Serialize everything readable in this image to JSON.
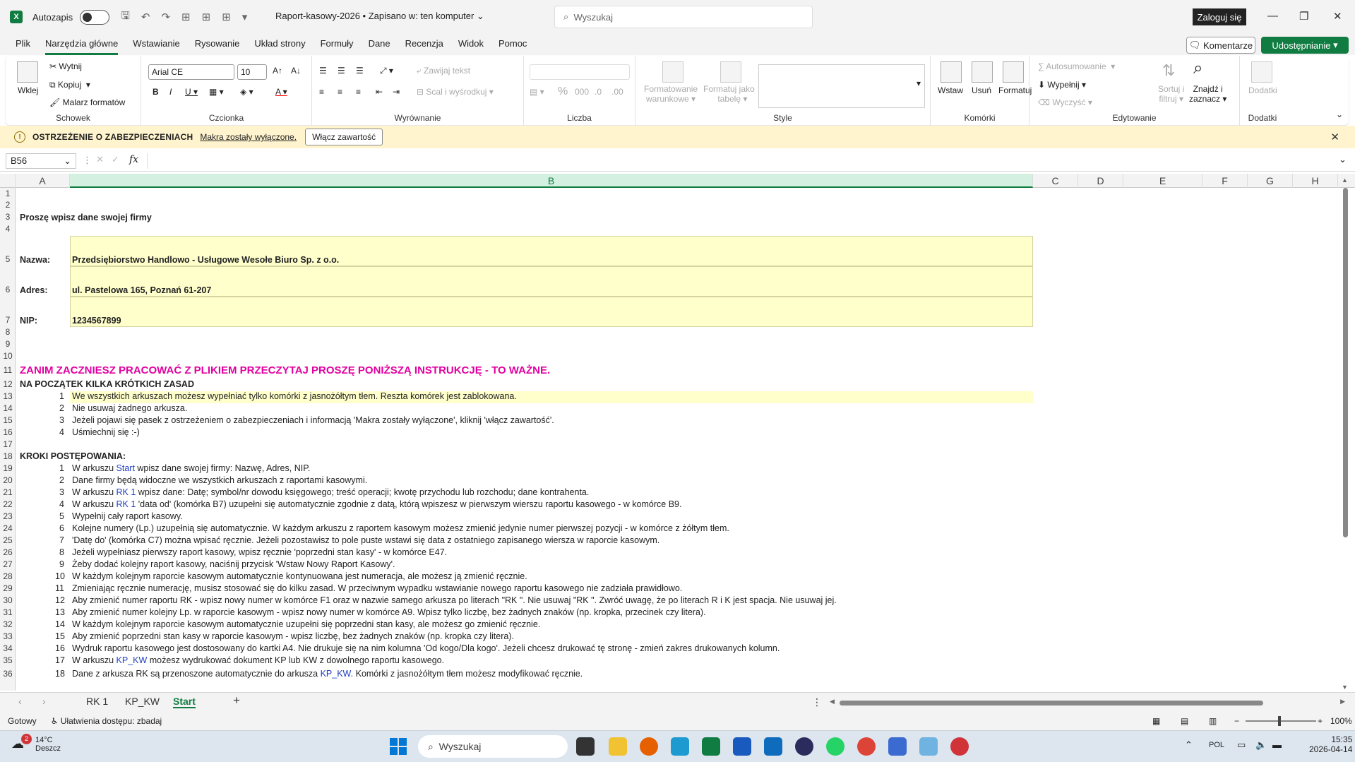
{
  "titlebar": {
    "app_icon": "excel-icon",
    "autosave_label": "Autozapis",
    "document_title": "Raport-kasowy-2026 • Zapisano w: ten komputer",
    "search_placeholder": "Wyszukaj",
    "signin_label": "Zaloguj się"
  },
  "menu": {
    "items": [
      "Plik",
      "Narzędzia główne",
      "Wstawianie",
      "Rysowanie",
      "Układ strony",
      "Formuły",
      "Dane",
      "Recenzja",
      "Widok",
      "Pomoc"
    ],
    "active": "Narzędzia główne",
    "comments_label": "Komentarze",
    "share_label": "Udostępnianie"
  },
  "ribbon": {
    "clipboard": {
      "paste": "Wklej",
      "cut": "Wytnij",
      "copy": "Kopiuj",
      "format_painter": "Malarz formatów",
      "group": "Schowek"
    },
    "font": {
      "family": "Arial CE",
      "size": "10",
      "group": "Czcionka"
    },
    "alignment": {
      "wrap": "Zawijaj tekst",
      "merge": "Scal i wyśrodkuj",
      "group": "Wyrównanie"
    },
    "number": {
      "group": "Liczba"
    },
    "styles": {
      "conditional_l1": "Formatowanie",
      "conditional_l2": "warunkowe",
      "table_l1": "Formatuj jako",
      "table_l2": "tabelę",
      "group": "Style"
    },
    "cells": {
      "insert": "Wstaw",
      "delete": "Usuń",
      "format": "Formatuj",
      "group": "Komórki"
    },
    "editing": {
      "autosum": "Autosumowanie",
      "fill": "Wypełnij",
      "clear": "Wyczyść",
      "sort_l1": "Sortuj i",
      "sort_l2": "filtruj",
      "find_l1": "Znajdź i",
      "find_l2": "zaznacz",
      "group": "Edytowanie"
    },
    "addins": {
      "label": "Dodatki",
      "group": "Dodatki"
    }
  },
  "security_bar": {
    "title": "OSTRZEŻENIE O ZABEZPIECZENIACH",
    "message": "Makra zostały wyłączone.",
    "button": "Włącz zawartość"
  },
  "formula_bar": {
    "name_box": "B56",
    "fx": "fx",
    "formula": ""
  },
  "columns": [
    "A",
    "B",
    "C",
    "D",
    "E",
    "F",
    "G",
    "H"
  ],
  "rows": [
    "1",
    "2",
    "3",
    "4",
    "5",
    "6",
    "7",
    "8",
    "9",
    "10",
    "11",
    "12",
    "13",
    "14",
    "15",
    "16",
    "17",
    "18",
    "19",
    "20",
    "21",
    "22",
    "23",
    "24",
    "25",
    "26",
    "27",
    "28",
    "29",
    "30",
    "31",
    "32",
    "33",
    "34",
    "35",
    "36"
  ],
  "sheet": {
    "r3": "Proszę wpisz dane swojej firmy",
    "r5_label": "Nazwa:",
    "r5_value": "Przedsiębiorstwo Handlowo - Usługowe Wesołe Biuro Sp. z o.o.",
    "r6_label": "Adres:",
    "r6_value": "ul. Pastelowa 165, Poznań 61-207",
    "r7_label": "NIP:",
    "r7_value": "1234567899",
    "r11": "ZANIM ZACZNIESZ PRACOWAĆ Z PLIKIEM PRZECZYTAJ PROSZĘ PONIŻSZĄ INSTRUKCJĘ - TO WAŻNE.",
    "r12": "NA POCZĄTEK KILKA KRÓTKICH ZASAD",
    "rules": [
      {
        "n": "1",
        "t": "We wszystkich arkuszach możesz wypełniać tylko komórki z jasnożółtym tłem. Reszta komórek jest zablokowana."
      },
      {
        "n": "2",
        "t": "Nie usuwaj żadnego arkusza."
      },
      {
        "n": "3",
        "t": "Jeżeli pojawi się pasek z ostrzeżeniem o zabezpieczeniach i informacją 'Makra zostały wyłączone', kliknij 'włącz zawartość'."
      },
      {
        "n": "4",
        "t": "Uśmiechnij się :-)"
      }
    ],
    "r18": "KROKI POSTĘPOWANIA:",
    "steps": [
      {
        "n": "1",
        "pre": "W arkuszu ",
        "link": "Start",
        "post": " wpisz dane swojej firmy: Nazwę, Adres, NIP."
      },
      {
        "n": "2",
        "pre": "Dane firmy będą widoczne we wszystkich arkuszach z raportami kasowymi.",
        "link": "",
        "post": ""
      },
      {
        "n": "3",
        "pre": "W arkuszu ",
        "link": "RK 1",
        "post": " wpisz dane: Datę; symbol/nr dowodu księgowego; treść operacji; kwotę przychodu lub rozchodu; dane kontrahenta."
      },
      {
        "n": "4",
        "pre": "W arkuszu ",
        "link": "RK 1",
        "post": " 'data od' (komórka B7) uzupełni się automatycznie zgodnie z datą, którą wpiszesz w pierwszym wierszu raportu kasowego - w komórce B9."
      },
      {
        "n": "5",
        "pre": "Wypełnij cały raport kasowy.",
        "link": "",
        "post": ""
      },
      {
        "n": "6",
        "pre": "Kolejne numery (Lp.) uzupełnią się automatycznie. W każdym arkuszu z raportem kasowym możesz zmienić jedynie numer pierwszej pozycji - w komórce z żółtym tłem.",
        "link": "",
        "post": ""
      },
      {
        "n": "7",
        "pre": "'Datę do' (komórka C7) można wpisać ręcznie. Jeżeli pozostawisz to pole puste wstawi się data z ostatniego zapisanego wiersza w raporcie kasowym.",
        "link": "",
        "post": ""
      },
      {
        "n": "8",
        "pre": "Jeżeli wypełniasz pierwszy raport kasowy, wpisz ręcznie 'poprzedni stan kasy' - w komórce E47.",
        "link": "",
        "post": ""
      },
      {
        "n": "9",
        "pre": "Żeby dodać kolejny raport kasowy, naciśnij przycisk 'Wstaw Nowy Raport Kasowy'.",
        "link": "",
        "post": ""
      },
      {
        "n": "10",
        "pre": "W każdym kolejnym raporcie kasowym automatycznie kontynuowana jest numeracja, ale możesz ją zmienić ręcznie.",
        "link": "",
        "post": ""
      },
      {
        "n": "11",
        "pre": "Zmieniając ręcznie numerację, musisz stosować się do kilku zasad. W przeciwnym wypadku wstawianie nowego raportu kasowego nie zadziała prawidłowo.",
        "link": "",
        "post": ""
      },
      {
        "n": "12",
        "pre": "Aby zmienić numer raportu RK - wpisz nowy numer w komórce F1 oraz w nazwie samego arkusza po literach \"RK \". Nie usuwaj \"RK \". Zwróć uwagę, że po literach R i K jest spacja. Nie usuwaj jej.",
        "link": "",
        "post": ""
      },
      {
        "n": "13",
        "pre": "Aby zmienić numer kolejny Lp. w raporcie kasowym - wpisz nowy numer w komórce A9. Wpisz tylko liczbę, bez żadnych znaków (np. kropka, przecinek czy litera).",
        "link": "",
        "post": ""
      },
      {
        "n": "14",
        "pre": "W każdym kolejnym raporcie kasowym automatycznie uzupełni się poprzedni stan kasy, ale możesz go zmienić ręcznie.",
        "link": "",
        "post": ""
      },
      {
        "n": "15",
        "pre": "Aby zmienić poprzedni stan kasy w raporcie kasowym - wpisz liczbę, bez żadnych znaków (np. kropka czy litera).",
        "link": "",
        "post": ""
      },
      {
        "n": "16",
        "pre": "Wydruk raportu kasowego jest dostosowany do kartki A4. Nie drukuje się na nim kolumna 'Od kogo/Dla kogo'. Jeżeli chcesz drukować tę stronę - zmień zakres drukowanych kolumn.",
        "link": "",
        "post": ""
      },
      {
        "n": "17",
        "pre": "W arkuszu ",
        "link": "KP_KW",
        "post": " możesz wydrukować dokument KP lub KW z dowolnego raportu kasowego."
      },
      {
        "n": "18",
        "pre": "Dane z arkusza RK są przenoszone automatycznie do arkusza ",
        "link": "KP_KW",
        "post": ". Komórki z jasnożółtym tłem możesz modyfikować ręcznie."
      }
    ]
  },
  "tabs": {
    "items": [
      "RK 1",
      "KP_KW",
      "Start"
    ],
    "active": "Start",
    "add": "+"
  },
  "status": {
    "ready": "Gotowy",
    "accessibility": "Ułatwienia dostępu: zbadaj",
    "zoom": "100%"
  },
  "taskbar": {
    "weather_temp": "14°C",
    "weather_desc": "Deszcz",
    "weather_badge": "2",
    "search": "Wyszukaj",
    "lang": "POL",
    "time": "15:35",
    "date": "2026-04-14"
  },
  "colors": {
    "accent": "#107c41",
    "warning_bg": "#fff4ce",
    "input_cell": "#ffffcc",
    "heading_magenta": "#e100a0",
    "link_blue": "#1f3fbf"
  }
}
